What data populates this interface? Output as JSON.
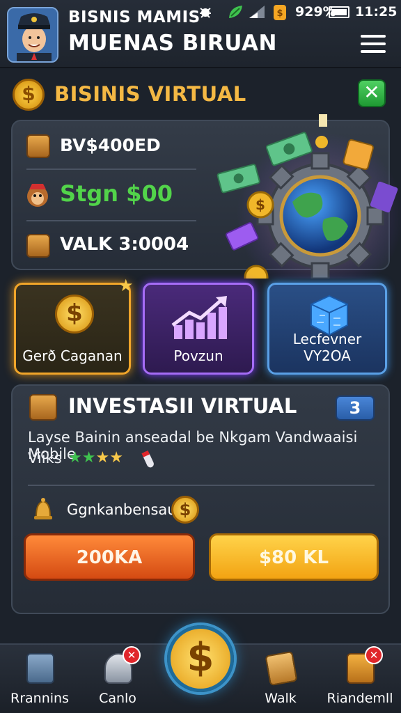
{
  "header": {
    "app_name": "BISNIS MAMIS",
    "app_subtitle": "MUENAS BIRUAN",
    "status": {
      "battery": "929%",
      "time": "11:25"
    }
  },
  "section": {
    "title": "BISINIS VIRTUAL"
  },
  "stats": [
    {
      "icon": "box-icon",
      "text": "BV$400ED"
    },
    {
      "icon": "monkey-icon",
      "text": "Stgn $00"
    },
    {
      "icon": "box-icon",
      "text": "VALK 3:0004"
    }
  ],
  "cards": [
    {
      "icon": "coin-icon",
      "label": "Gerð Caganan"
    },
    {
      "icon": "chart-up-icon",
      "label": "Povzun"
    },
    {
      "icon": "cube-icon",
      "label": "Lecfevner VY2OA"
    }
  ],
  "investment": {
    "title": "INVESTASII VIRTUAL",
    "badge": "3",
    "description": "Layse Bainin anseadal be Nkgam Vandwaaisi Mobile",
    "description_line2": "Viiks",
    "stars": 4,
    "reward_label": "Ggnkanbensau",
    "button_left": "200KA",
    "button_right": "$80 KL"
  },
  "nav": [
    {
      "label": "Rrannins",
      "icon": "box-icon"
    },
    {
      "label": "Canlo",
      "icon": "trophy-icon"
    },
    {
      "label": "Walk",
      "icon": "scroll-icon"
    },
    {
      "label": "Riandemll",
      "icon": "lock-box-icon"
    }
  ],
  "colors": {
    "accent_gold": "#f4b844",
    "background": "#1c222b",
    "green": "#3fc24f",
    "orange": "#e85c1a"
  }
}
